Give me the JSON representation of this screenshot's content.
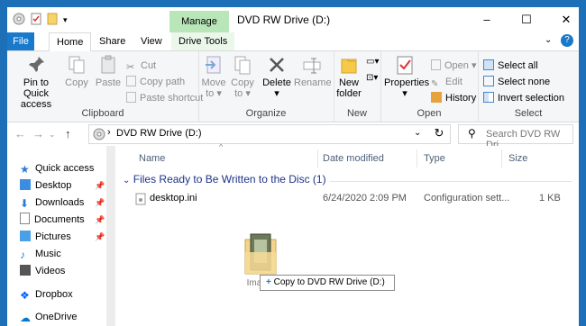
{
  "window": {
    "title": "DVD RW Drive (D:)",
    "manage_tab": "Manage",
    "controls": [
      "–",
      "☐",
      "✕"
    ]
  },
  "ribbon_tabs": [
    "File",
    "Home",
    "Share",
    "View",
    "Drive Tools"
  ],
  "clipboard": {
    "pin_label_1": "Pin to Quick",
    "pin_label_2": "access",
    "copy": "Copy",
    "paste": "Paste",
    "cut": "Cut",
    "copy_path": "Copy path",
    "paste_shortcut": "Paste shortcut",
    "group": "Clipboard"
  },
  "organize": {
    "move_1": "Move",
    "move_2": "to",
    "copy_1": "Copy",
    "copy_2": "to",
    "delete": "Delete",
    "rename": "Rename",
    "group": "Organize"
  },
  "new": {
    "folder_1": "New",
    "folder_2": "folder",
    "group": "New"
  },
  "open": {
    "properties": "Properties",
    "open": "Open",
    "edit": "Edit",
    "history": "History",
    "group": "Open"
  },
  "select": {
    "all": "Select all",
    "none": "Select none",
    "invert": "Invert selection",
    "group": "Select"
  },
  "address": {
    "path": "DVD RW Drive (D:)",
    "search_placeholder": "Search DVD RW Dri..."
  },
  "nav": {
    "items": [
      {
        "label": "Quick access",
        "icon": "star-icon",
        "pinned": false
      },
      {
        "label": "Desktop",
        "icon": "desktop-icon",
        "pinned": true
      },
      {
        "label": "Downloads",
        "icon": "download-icon",
        "pinned": true
      },
      {
        "label": "Documents",
        "icon": "documents-icon",
        "pinned": true
      },
      {
        "label": "Pictures",
        "icon": "pictures-icon",
        "pinned": true
      },
      {
        "label": "Music",
        "icon": "music-icon",
        "pinned": false
      },
      {
        "label": "Videos",
        "icon": "videos-icon",
        "pinned": false
      },
      {
        "label": "Dropbox",
        "icon": "dropbox-icon",
        "pinned": false
      },
      {
        "label": "OneDrive",
        "icon": "onedrive-icon",
        "pinned": false
      }
    ]
  },
  "columns": [
    "Name",
    "Date modified",
    "Type",
    "Size"
  ],
  "group_header": "Files Ready to Be Written to the Disc (1)",
  "files": [
    {
      "name": "desktop.ini",
      "date": "6/24/2020 2:09 PM",
      "type": "Configuration sett...",
      "size": "1 KB"
    }
  ],
  "drag": {
    "label": "Images",
    "tip": "Copy to DVD RW Drive (D:)"
  },
  "colors": {
    "accent": "#1979ca",
    "manage_tab": "#b8e6b8",
    "group_header": "#1e3287"
  }
}
